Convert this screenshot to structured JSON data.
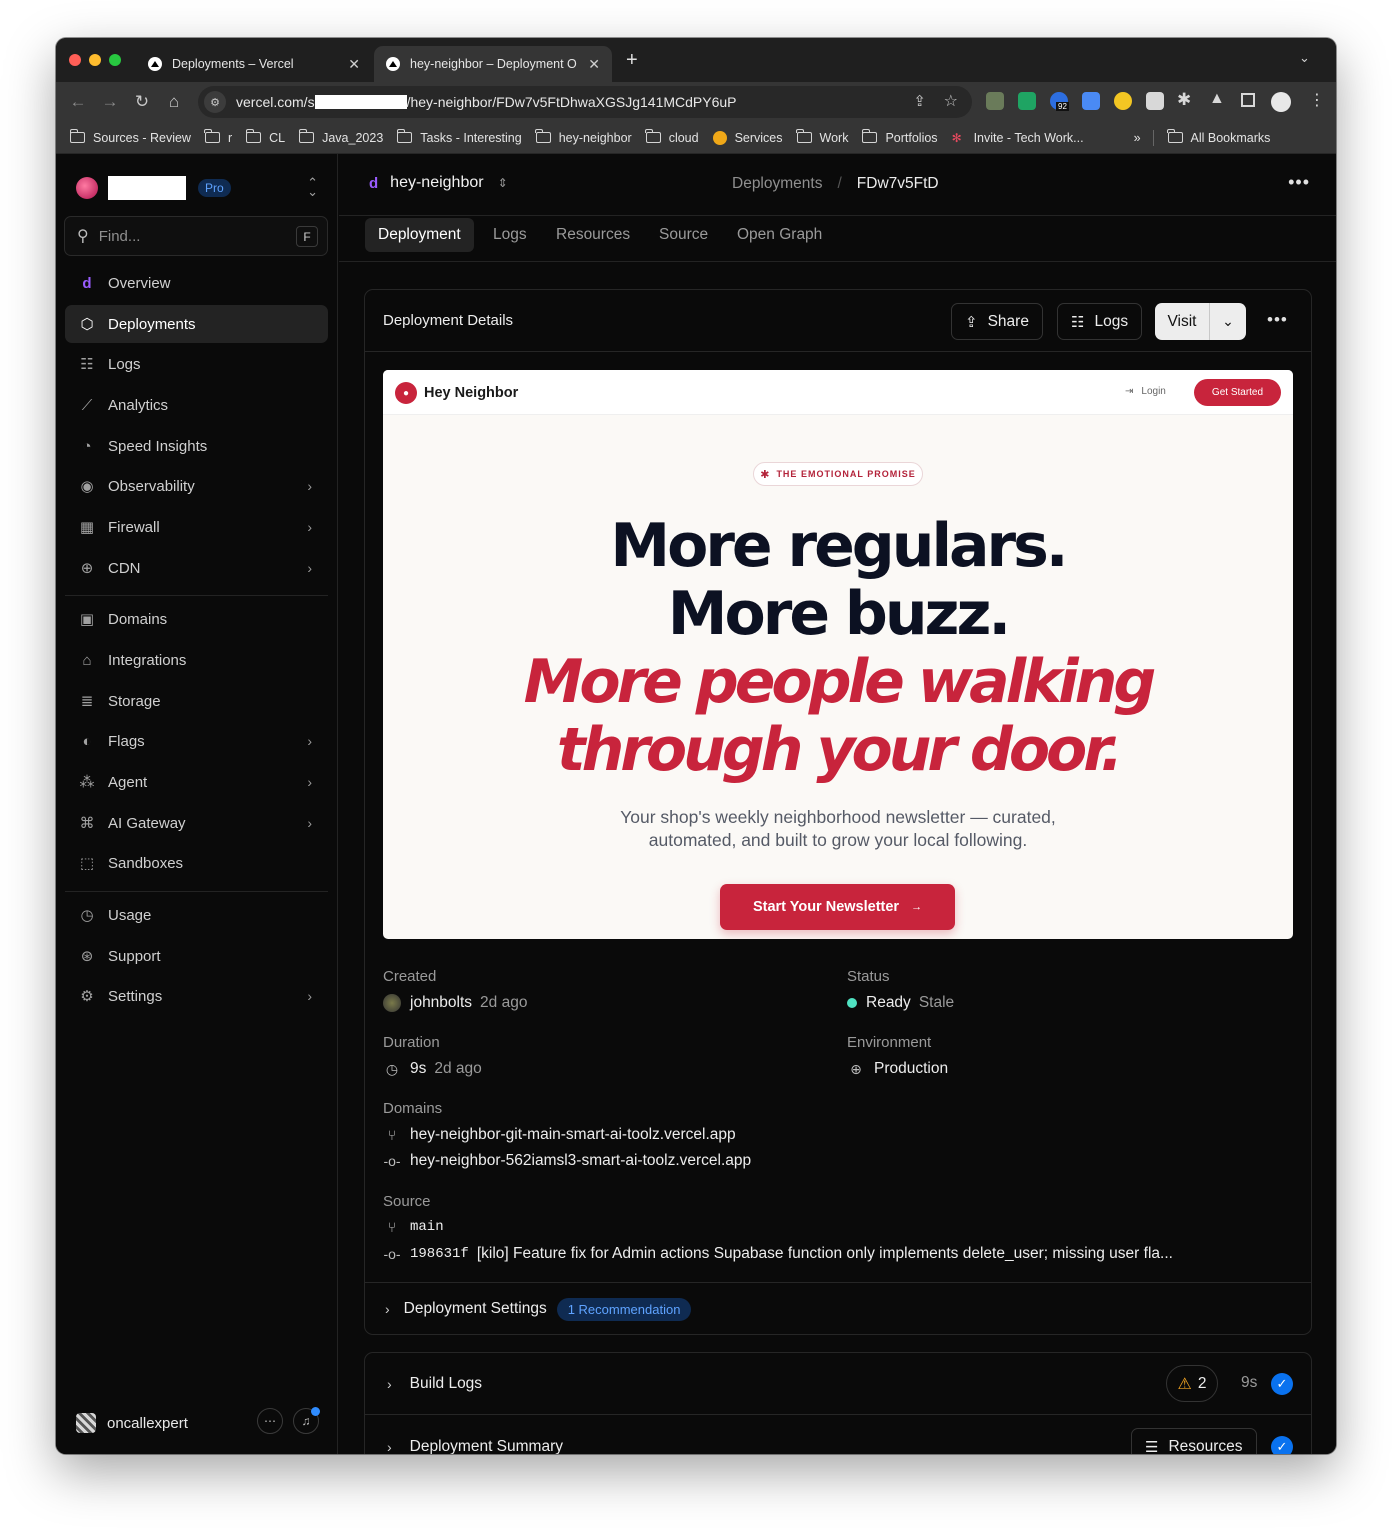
{
  "browser": {
    "tabs": [
      {
        "title": "Deployments – Vercel"
      },
      {
        "title": "hey-neighbor – Deployment O"
      }
    ],
    "new_tab": "+",
    "url_prefix": "vercel.com/s",
    "url_suffix": "/hey-neighbor/FDw7v5FtDhwaXGSJg141MCdPY6uP",
    "ext_badge": "92",
    "bookmarks": [
      "Sources - Review",
      "r",
      "CL",
      "Java_2023",
      "Tasks - Interesting",
      "hey-neighbor",
      "cloud",
      "Services",
      "Work",
      "Portfolios",
      "Invite - Tech Work..."
    ],
    "bookmarks_overflow": "»",
    "all_bookmarks": "All Bookmarks"
  },
  "sidebar": {
    "plan_badge": "Pro",
    "find_placeholder": "Find...",
    "find_shortcut": "F",
    "nav": [
      {
        "label": "Overview",
        "icon": "vercel-project-icon"
      },
      {
        "label": "Deployments",
        "icon": "cube-icon",
        "active": true
      },
      {
        "label": "Logs",
        "icon": "list-icon"
      },
      {
        "label": "Analytics",
        "icon": "chart-line-icon"
      },
      {
        "label": "Speed Insights",
        "icon": "gauge-icon"
      },
      {
        "label": "Observability",
        "icon": "eye-icon",
        "chevron": true
      },
      {
        "label": "Firewall",
        "icon": "firewall-icon",
        "chevron": true
      },
      {
        "label": "CDN",
        "icon": "globe-icon",
        "chevron": true
      },
      {
        "label": "Domains",
        "icon": "domain-icon"
      },
      {
        "label": "Integrations",
        "icon": "store-icon"
      },
      {
        "label": "Storage",
        "icon": "database-icon"
      },
      {
        "label": "Flags",
        "icon": "toggle-icon",
        "chevron": true
      },
      {
        "label": "Agent",
        "icon": "sparkle-icon",
        "chevron": true
      },
      {
        "label": "AI Gateway",
        "icon": "gateway-icon",
        "chevron": true
      },
      {
        "label": "Sandboxes",
        "icon": "sandbox-icon"
      },
      {
        "label": "Usage",
        "icon": "pie-icon"
      },
      {
        "label": "Support",
        "icon": "lifebuoy-icon"
      },
      {
        "label": "Settings",
        "icon": "gear-icon",
        "chevron": true
      }
    ],
    "username": "oncallexpert"
  },
  "topbar": {
    "project": "hey-neighbor",
    "breadcrumb_parent": "Deployments",
    "breadcrumb_current": "FDw7v5FtD"
  },
  "subtabs": [
    "Deployment",
    "Logs",
    "Resources",
    "Source",
    "Open Graph"
  ],
  "card": {
    "title": "Deployment Details",
    "share": "Share",
    "logs": "Logs",
    "visit": "Visit"
  },
  "preview": {
    "brand": "Hey Neighbor",
    "login": "Login",
    "get_started": "Get Started",
    "badge": "THE EMOTIONAL PROMISE",
    "headline_1": "More regulars.",
    "headline_2": "More buzz.",
    "headline_3": "More people walking",
    "headline_4": "through your door.",
    "subtitle_1": "Your shop's weekly neighborhood newsletter — curated,",
    "subtitle_2": "automated, and built to grow your local following.",
    "cta": "Start Your Newsletter",
    "brand_color": "#c8243c"
  },
  "details": {
    "created_label": "Created",
    "created_user": "johnbolts",
    "created_ago": "2d ago",
    "status_label": "Status",
    "status_ready": "Ready",
    "status_stale": "Stale",
    "duration_label": "Duration",
    "duration": "9s",
    "duration_ago": "2d ago",
    "environment_label": "Environment",
    "environment": "Production",
    "domains_label": "Domains",
    "domain_1": "hey-neighbor-git-main-smart-ai-toolz.vercel.app",
    "domain_2": "hey-neighbor-562iamsl3-smart-ai-toolz.vercel.app",
    "source_label": "Source",
    "branch": "main",
    "commit_hash": "198631f",
    "commit_msg": "[kilo] Feature fix for Admin actions Supabase function only implements delete_user; missing user fla..."
  },
  "settings": {
    "label": "Deployment Settings",
    "recommendation": "1 Recommendation"
  },
  "build": {
    "build_logs": "Build Logs",
    "warnings": "2",
    "duration": "9s",
    "summary": "Deployment Summary",
    "resources": "Resources"
  },
  "colors": {
    "accent_blue": "#0a72ef",
    "ready_green": "#50e3c2",
    "warning": "#f5a623"
  }
}
